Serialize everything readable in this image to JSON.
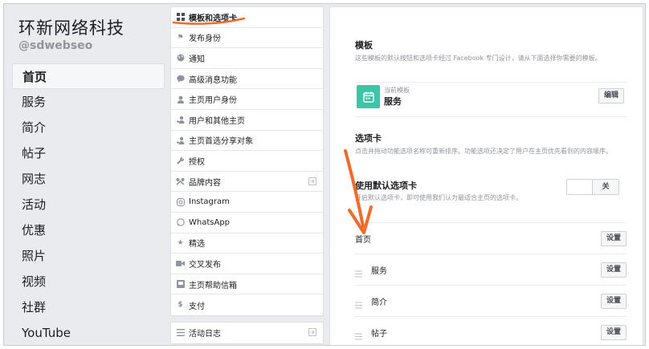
{
  "page": {
    "name": "环新网络科技",
    "username": "@sdwebseo"
  },
  "left_nav": [
    "首页",
    "服务",
    "简介",
    "帖子",
    "网志",
    "活动",
    "优惠",
    "照片",
    "视频",
    "社群",
    "YouTube"
  ],
  "settings_menu": [
    {
      "label": "模板和选项卡",
      "icon": "grid-icon"
    },
    {
      "label": "发布身份",
      "icon": "flag-icon"
    },
    {
      "label": "通知",
      "icon": "globe-icon"
    },
    {
      "label": "高级消息功能",
      "icon": "speech-bubble-icon"
    },
    {
      "label": "主页用户身份",
      "icon": "person-icon"
    },
    {
      "label": "用户和其他主页",
      "icon": "people-icon"
    },
    {
      "label": "主页首选分享对象",
      "icon": "person-plus-icon"
    },
    {
      "label": "授权",
      "icon": "wrench-icon"
    },
    {
      "label": "品牌内容",
      "icon": "handshake-icon"
    },
    {
      "label": "Instagram",
      "icon": "instagram-icon"
    },
    {
      "label": "WhatsApp",
      "icon": "whatsapp-icon"
    },
    {
      "label": "精选",
      "icon": "star-icon"
    },
    {
      "label": "交叉发布",
      "icon": "video-camera-icon"
    },
    {
      "label": "主页帮助信箱",
      "icon": "inbox-icon"
    },
    {
      "label": "支付",
      "icon": "dollar-icon"
    }
  ],
  "activity_log": {
    "label": "活动日志",
    "icon": "list-icon"
  },
  "template": {
    "title": "模板",
    "desc": "这些模板的默认按钮和选项卡经过 Facebook 专门设计，请从下面选择你需要的模板。",
    "current_label": "当前模板",
    "current_name": "服务",
    "edit_button": "编辑"
  },
  "tabs_section": {
    "title": "选项卡",
    "desc": "点击并拖动功能选项名称可重新排序。功能选项还决定了用户在主页优先看到的内容顺序。",
    "default_title": "使用默认选项卡",
    "default_desc": "开启默认选项卡，即可使用我们认为最适合主页的选项卡。",
    "toggle_label": "关",
    "setting_button": "设置",
    "tabs": [
      "首页",
      "服务",
      "简介",
      "帖子"
    ]
  },
  "colors": {
    "template_icon": "#3cc6a7",
    "annotation": "#f26b2a"
  }
}
